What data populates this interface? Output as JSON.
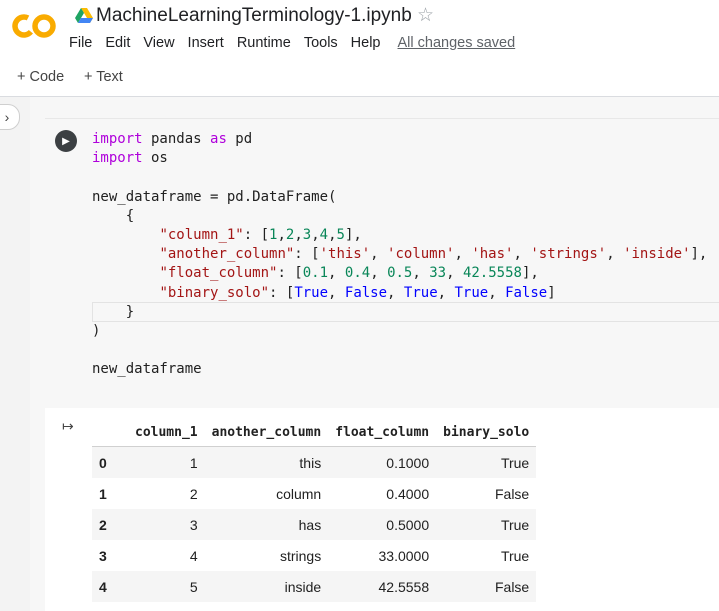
{
  "app": {
    "logo_text": "CO",
    "title": "MachineLearningTerminology-1.ipynb",
    "saved_status": "All changes saved"
  },
  "menu": [
    "File",
    "Edit",
    "View",
    "Insert",
    "Runtime",
    "Tools",
    "Help"
  ],
  "toolbar": {
    "add_code": "+ Code",
    "add_text": "+ Text"
  },
  "code_lines": [
    "import pandas as pd",
    "import os",
    "",
    "new_dataframe = pd.DataFrame(",
    "    {",
    "        \"column_1\": [1,2,3,4,5],",
    "        \"another_column\": ['this', 'column', 'has', 'strings', 'inside'],",
    "        \"float_column\": [0.1, 0.4, 0.5, 33, 42.5558],",
    "        \"binary_solo\": [True, False, True, True, False]",
    "    }",
    ")",
    "",
    "new_dataframe"
  ],
  "table": {
    "columns": [
      "",
      "column_1",
      "another_column",
      "float_column",
      "binary_solo"
    ],
    "rows": [
      [
        "0",
        "1",
        "this",
        "0.1000",
        "True"
      ],
      [
        "1",
        "2",
        "column",
        "0.4000",
        "False"
      ],
      [
        "2",
        "3",
        "has",
        "0.5000",
        "True"
      ],
      [
        "3",
        "4",
        "strings",
        "33.0000",
        "True"
      ],
      [
        "4",
        "5",
        "inside",
        "42.5558",
        "False"
      ]
    ]
  },
  "colors": {
    "logo_orange": "#f9ab00",
    "keyword": "#af00db",
    "string": "#a31515",
    "number": "#098658",
    "boolean": "#0000ff"
  }
}
